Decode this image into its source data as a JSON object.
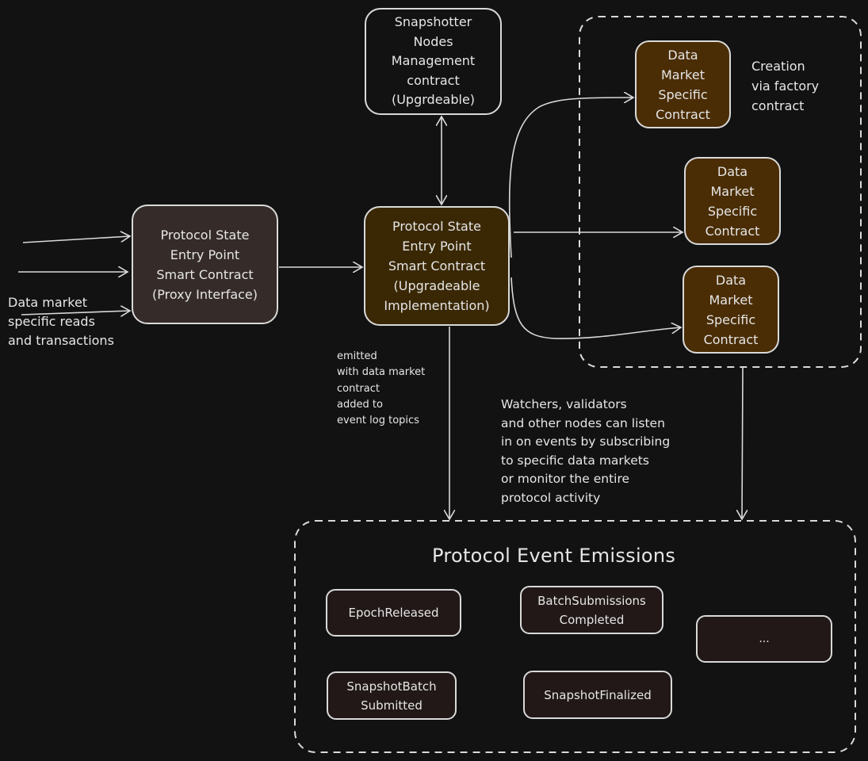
{
  "diagram": {
    "title": "Protocol Event Emissions",
    "nodes": {
      "proxy": {
        "label": "Protocol State\nEntry Point\nSmart Contract\n(Proxy Interface)",
        "fill": "#352b28"
      },
      "implementation": {
        "label": "Protocol State\nEntry Point\nSmart Contract\n(Upgradeable\nImplementation)",
        "fill": "#3a2805"
      },
      "snapshotter_management": {
        "label": "Snapshotter\nNodes\nManagement\ncontract\n(Upgrdeable)",
        "fill": "#121212"
      },
      "data_markets": [
        {
          "label": "Data\nMarket\nSpecific\nContract"
        },
        {
          "label": "Data\nMarket\nSpecific\nContract"
        },
        {
          "label": "Data\nMarket\nSpecific\nContract"
        }
      ],
      "data_market_fill": "#4a2d05"
    },
    "annotations": {
      "inputs": "Data market\nspecific reads\nand transactions",
      "emitted": "emitted\nwith data market\ncontract\nadded to\nevent log topics",
      "watchers": "Watchers, validators\nand other nodes can listen\nin on events by subscribing\nto specific data markets\nor monitor the entire\nprotocol activity",
      "creation": "Creation\nvia factory\ncontract"
    },
    "events": [
      {
        "label": "EpochReleased"
      },
      {
        "label": "BatchSubmissions\nCompleted"
      },
      {
        "label": "SnapshotBatch\nSubmitted"
      },
      {
        "label": "SnapshotFinalized"
      },
      {
        "label": "..."
      }
    ],
    "event_fill": "#211817",
    "colors": {
      "background": "#121212",
      "stroke": "#d9d9d9"
    }
  }
}
